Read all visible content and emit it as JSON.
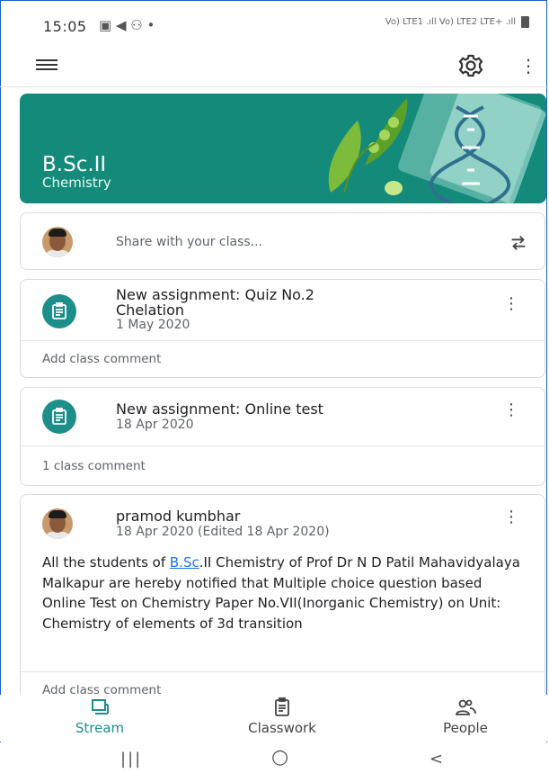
{
  "status_bar": {
    "time": "15:05",
    "icons_text": "▣ ◀ ⚇ •",
    "network": "Vo) LTE1 .ıll Vo) LTE2 LTE+ .ıll"
  },
  "app_bar": {
    "menu_icon": "hamburger-icon",
    "settings_icon": "gear-icon",
    "more_icon": "kebab-icon"
  },
  "banner": {
    "title": "B.Sc.II",
    "subtitle": "Chemistry",
    "color": "#138a7a"
  },
  "share": {
    "placeholder": "Share with your class..."
  },
  "stream": [
    {
      "type": "assignment",
      "title_line1": "New assignment: Quiz No.2",
      "title_line2": "Chelation",
      "date": "1 May 2020",
      "comment": "Add class comment"
    },
    {
      "type": "assignment",
      "title_line1": "New assignment: Online test",
      "date": "18 Apr 2020",
      "comment": "1 class comment"
    },
    {
      "type": "post",
      "author": "pramod kumbhar",
      "date": "18 Apr 2020 (Edited 18 Apr 2020)",
      "body_prefix": "All the students of ",
      "body_link": "B.Sc",
      "body_suffix": ".II Chemistry of Prof Dr N D Patil Mahavidyalaya Malkapur are hereby notified that Multiple choice question based Online Test on Chemistry Paper No.VII(Inorganic Chemistry) on Unit: Chemistry of elements of 3d transition",
      "comment": "Add class comment"
    }
  ],
  "bottom_nav": {
    "stream": "Stream",
    "classwork": "Classwork",
    "people": "People",
    "active_color": "#1e8e8a"
  },
  "system_nav": {
    "recents": "|||",
    "home": "○",
    "back": "<"
  }
}
